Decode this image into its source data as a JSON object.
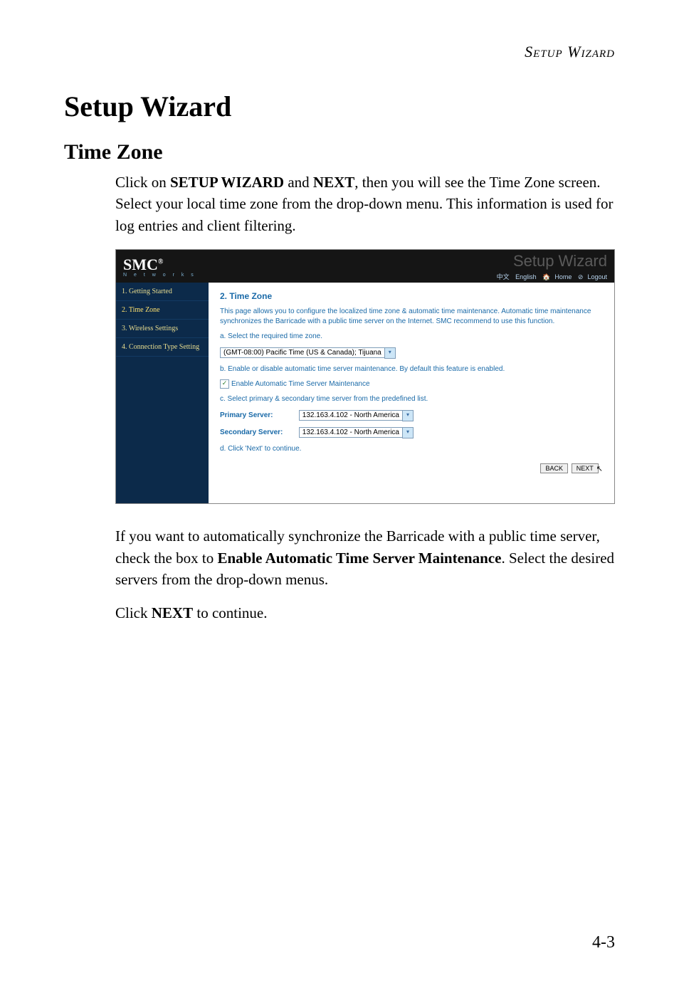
{
  "runningHeader": {
    "word1": "Setup",
    "word2": "Wizard"
  },
  "h1": "Setup Wizard",
  "h2": "Time Zone",
  "para1_a": "Click on ",
  "para1_b": "SETUP WIZARD",
  "para1_c": " and ",
  "para1_d": "NEXT",
  "para1_e": ", then you will see the Time Zone screen. Select your local time zone from the drop-down menu. This information is used for log entries and client filtering.",
  "para2_a": "If you want to automatically synchronize the Barricade with a public time server, check the box to ",
  "para2_b": "Enable Automatic Time Server Maintenance",
  "para2_c": ". Select the desired servers from the drop-down menus.",
  "para3_a": "Click ",
  "para3_b": "NEXT",
  "para3_c": " to continue.",
  "pageNum": "4-3",
  "shot": {
    "logo": "SMC",
    "logoSup": "®",
    "logoSub": "N e t w o r k s",
    "watermark": "Setup Wizard",
    "nav": {
      "lang1": "中文",
      "lang2": "English",
      "home": "Home",
      "logout": "Logout"
    },
    "sidebar": [
      "1. Getting Started",
      "2. Time Zone",
      "3. Wireless Settings",
      "4. Connection Type Setting"
    ],
    "content": {
      "heading": "2. Time Zone",
      "intro": "This page allows you to configure the localized time zone & automatic time maintenance. Automatic time maintenance synchronizes the Barricade with a public time server on the Internet. SMC recommend to use this function.",
      "stepA": "a. Select the required time zone.",
      "tzValue": "(GMT-08:00) Pacific Time (US & Canada); Tijuana",
      "stepB": "b. Enable or disable automatic time server maintenance. By default this feature is enabled.",
      "checkboxLabel": "Enable Automatic Time Server Maintenance",
      "stepC": "c. Select primary & secondary time server from the predefined list.",
      "primaryLabel": "Primary Server:",
      "primaryValue": "132.163.4.102 - North America",
      "secondaryLabel": "Secondary Server:",
      "secondaryValue": "132.163.4.102 - North America",
      "stepD": "d. Click 'Next' to continue.",
      "backBtn": "BACK",
      "nextBtn": "NEXT"
    }
  }
}
